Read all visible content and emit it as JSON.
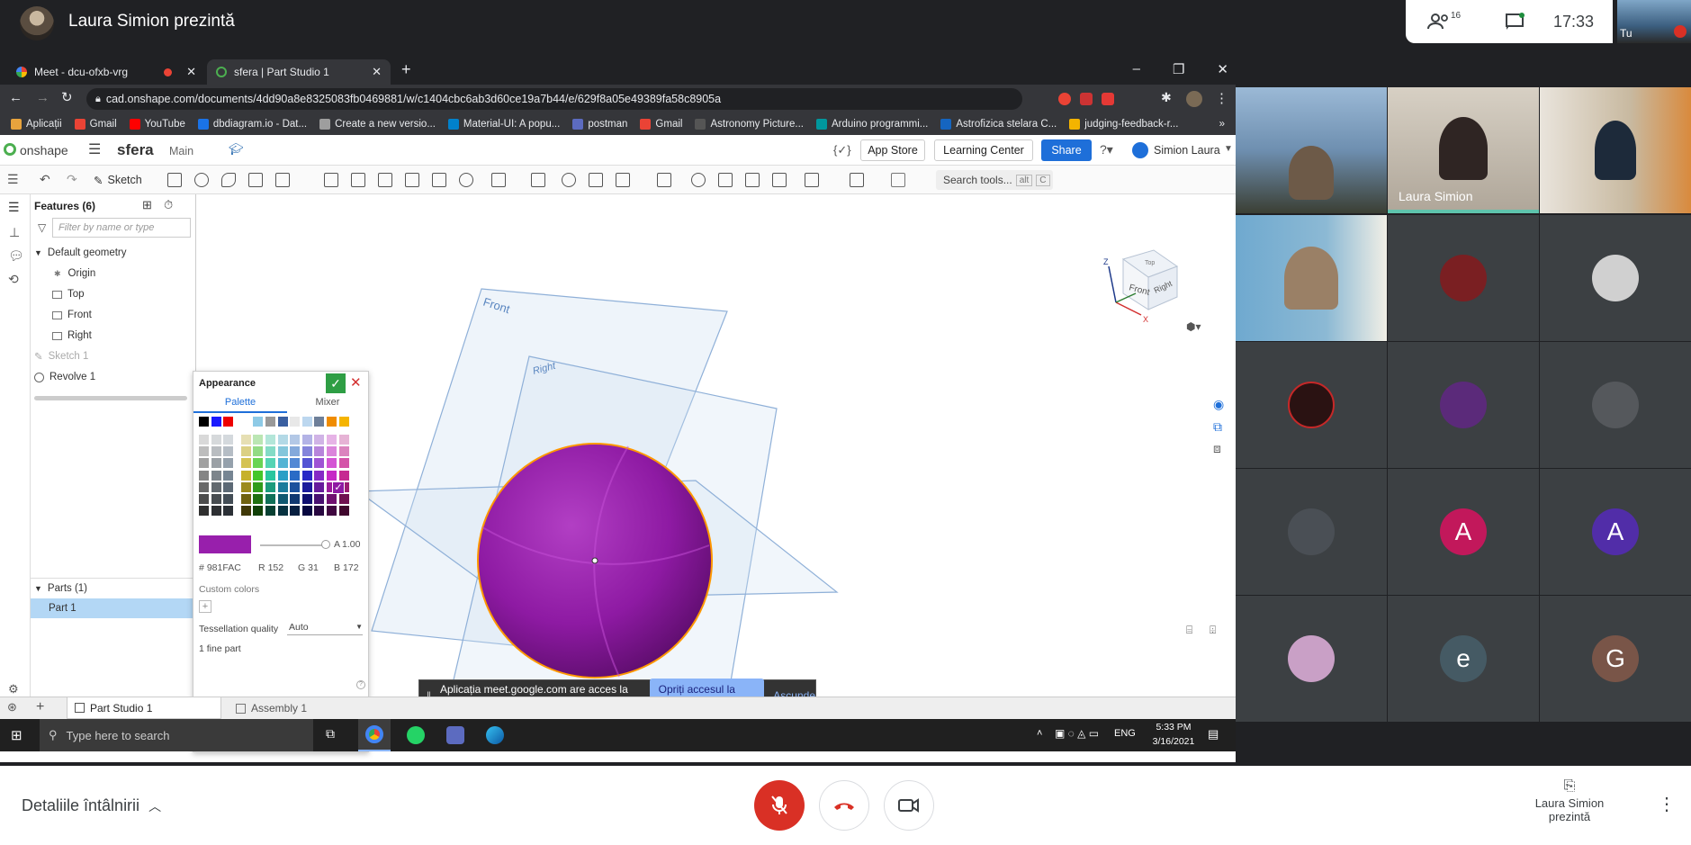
{
  "meet": {
    "presenter_title": "Laura Simion prezintă",
    "participants_count": "16",
    "clock": "17:33",
    "self_label": "Tu",
    "details_label": "Detaliile întâlnirii",
    "presenting_label_1": "Laura Simion",
    "presenting_label_2": "prezintă",
    "speaker_name": "Laura Simion",
    "tiles": [
      {
        "letter": "A",
        "color": "#c2185b"
      },
      {
        "letter": "A",
        "color": "#512da8"
      },
      {
        "letter": "e",
        "color": "#455a64"
      },
      {
        "letter": "G",
        "color": "#795548"
      }
    ]
  },
  "browser": {
    "tabs": [
      {
        "label": "Meet - dcu-ofxb-vrg"
      },
      {
        "label": "sfera | Part Studio 1"
      }
    ],
    "url": "cad.onshape.com/documents/4dd90a8e8325083fb0469881/w/c1404cbc6ab3d60ce19a7b44/e/629f8a05e49389fa58c8905a",
    "bookmarks": [
      {
        "label": "Aplicații",
        "color": "#e8a33d"
      },
      {
        "label": "Gmail",
        "color": "#ea4335"
      },
      {
        "label": "YouTube",
        "color": "#ff0000"
      },
      {
        "label": "dbdiagram.io - Dat...",
        "color": "#1a73e8"
      },
      {
        "label": "Create a new versio...",
        "color": "#9e9e9e"
      },
      {
        "label": "Material-UI: A popu...",
        "color": "#0081cb"
      },
      {
        "label": "postman",
        "color": "#5c6bc0"
      },
      {
        "label": "Gmail",
        "color": "#ea4335"
      },
      {
        "label": "Astronomy Picture...",
        "color": "#555555"
      },
      {
        "label": "Arduino programmi...",
        "color": "#00979d"
      },
      {
        "label": "Astrofizica stelara C...",
        "color": "#1565c0"
      },
      {
        "label": "judging-feedback-r...",
        "color": "#f4b400"
      }
    ]
  },
  "onshape": {
    "logo": "onshape",
    "doc_name": "sfera",
    "branch": "Main",
    "app_store": "App Store",
    "learning_center": "Learning Center",
    "share": "Share",
    "user": "Simion Laura",
    "sketch_label": "Sketch",
    "search_tools": "Search tools...",
    "search_shortcut_1": "alt",
    "search_shortcut_2": "C",
    "features_header": "Features (6)",
    "filter_placeholder": "Filter by name or type",
    "default_geometry": "Default geometry",
    "tree": [
      "Origin",
      "Top",
      "Front",
      "Right",
      "Sketch 1",
      "Revolve 1"
    ],
    "parts_header": "Parts (1)",
    "part_item": "Part 1",
    "plane_front": "Front",
    "plane_right": "Right",
    "viewcube_front": "Front",
    "viewcube_right": "Right",
    "viewcube_top": "Top",
    "axis_z": "Z",
    "axis_x": "X",
    "tab_part_studio": "Part Studio 1",
    "tab_assembly": "Assembly 1"
  },
  "appearance": {
    "title": "Appearance",
    "tab_palette": "Palette",
    "tab_mixer": "Mixer",
    "selected_color": "#981FAC",
    "alpha_label": "A",
    "alpha_value": "1.00",
    "hex_label": "#",
    "hex_value": "981FAC",
    "r_label": "R",
    "r_value": "152",
    "g_label": "G",
    "g_value": "31",
    "b_label": "B",
    "b_value": "172",
    "custom_colors": "Custom colors",
    "tessellation_label": "Tessellation quality",
    "tessellation_value": "Auto",
    "fine_part": "1 fine part"
  },
  "share_notice": {
    "text": "Aplicația meet.google.com are acces la ecran.",
    "stop": "Opriți accesul la ecran",
    "hide": "Ascunde"
  },
  "taskbar": {
    "search_placeholder": "Type here to search",
    "lang": "ENG",
    "time": "5:33 PM",
    "date": "3/16/2021"
  }
}
